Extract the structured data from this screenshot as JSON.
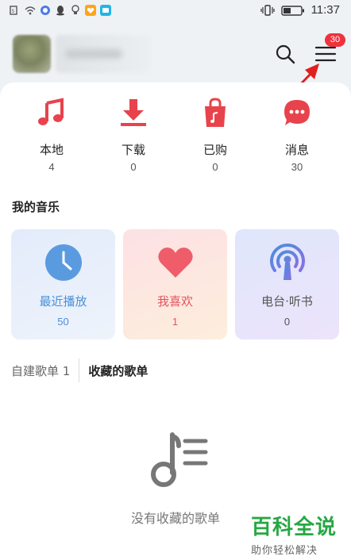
{
  "status_bar": {
    "time": "11:37",
    "icons": [
      "sim-icon",
      "wifi-icon",
      "message-icon",
      "qq-icon",
      "bulb-icon",
      "heart-app-icon",
      "tv-app-icon",
      "vibrate-icon",
      "battery-icon"
    ]
  },
  "header": {
    "menu_badge": "30"
  },
  "quick_actions": [
    {
      "label": "本地",
      "count": "4",
      "icon": "music-note-icon"
    },
    {
      "label": "下载",
      "count": "0",
      "icon": "download-icon"
    },
    {
      "label": "已购",
      "count": "0",
      "icon": "shopping-bag-icon"
    },
    {
      "label": "消息",
      "count": "30",
      "icon": "message-bubble-icon"
    }
  ],
  "my_music": {
    "title": "我的音乐",
    "cards": [
      {
        "label": "最近播放",
        "count": "50",
        "icon": "clock-icon"
      },
      {
        "label": "我喜欢",
        "count": "1",
        "icon": "heart-icon"
      },
      {
        "label": "电台·听书",
        "count": "0",
        "icon": "radio-icon"
      }
    ]
  },
  "playlist_tabs": [
    {
      "label": "自建歌单 1",
      "active": false
    },
    {
      "label": "收藏的歌单",
      "active": true
    }
  ],
  "empty_state": {
    "text": "没有收藏的歌单",
    "icon": "playlist-music-icon"
  },
  "watermark": {
    "title": "百科全说",
    "subtitle": "助你轻松解决"
  },
  "colors": {
    "accent_red": "#e8434c",
    "recent_blue": "#4a90d9",
    "fav_red": "#e4545d",
    "badge": "#f0323c",
    "watermark_green": "#27a744"
  }
}
